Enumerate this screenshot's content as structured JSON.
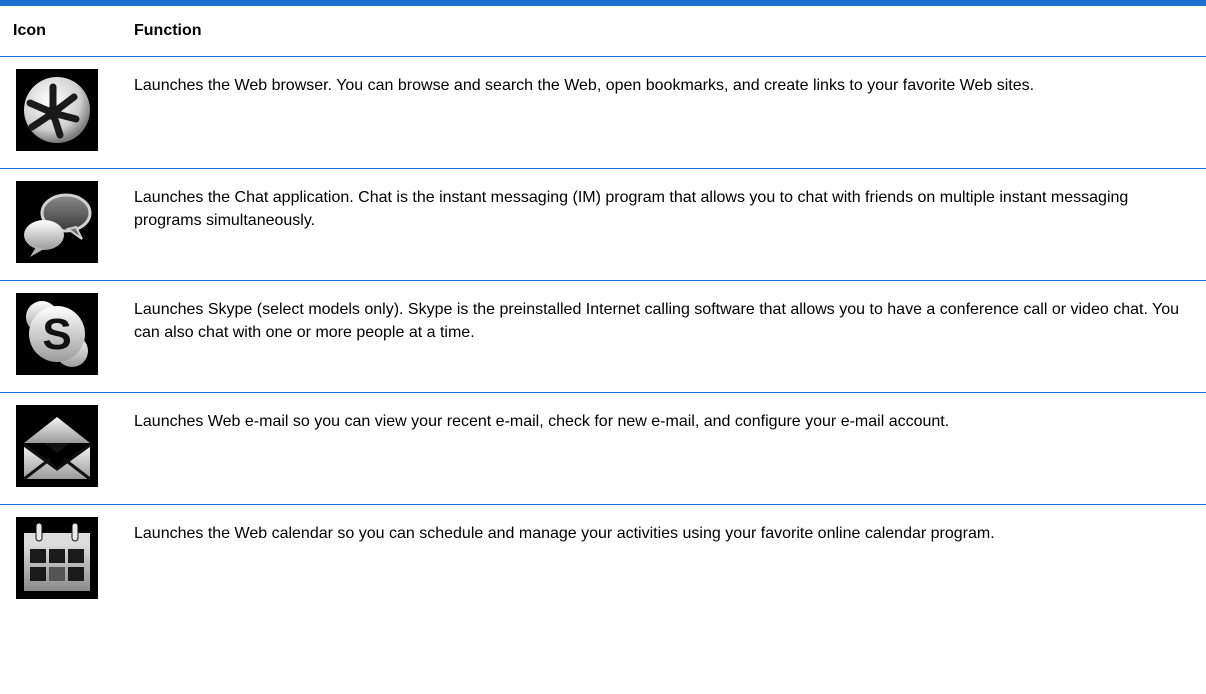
{
  "table": {
    "header": {
      "icon": "Icon",
      "function": "Function"
    },
    "rows": [
      {
        "icon": "web-browser-icon",
        "text": "Launches the Web browser. You can browse and search the Web, open bookmarks, and create links to your favorite Web sites."
      },
      {
        "icon": "chat-icon",
        "text": "Launches the Chat application. Chat is the instant messaging (IM) program that allows you to chat with friends on multiple instant messaging programs simultaneously."
      },
      {
        "icon": "skype-icon",
        "text": "Launches Skype (select models only). Skype is the preinstalled Internet calling software that allows you to have a conference call or video chat. You can also chat with one or more people at a time."
      },
      {
        "icon": "email-icon",
        "text": "Launches Web e-mail so you can view your recent e-mail, check for new e-mail, and configure your e-mail account."
      },
      {
        "icon": "calendar-icon",
        "text": "Launches the Web calendar so you can schedule and manage your activities using your favorite online calendar program."
      }
    ]
  },
  "colors": {
    "rule": "#1a6fd0",
    "icon_background": "#000000"
  }
}
